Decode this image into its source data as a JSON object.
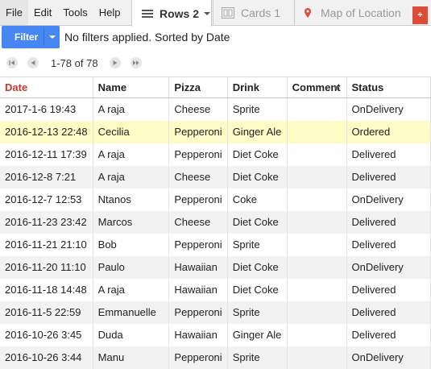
{
  "menu": {
    "file": "File",
    "edit": "Edit",
    "tools": "Tools",
    "help": "Help"
  },
  "tabs": [
    {
      "label": "Rows 2",
      "icon": "rows-icon",
      "active": true
    },
    {
      "label": "Cards 1",
      "icon": "cards-icon",
      "active": false
    },
    {
      "label": "Map of Location",
      "icon": "map-pin-icon",
      "active": false
    }
  ],
  "add_tab_label": "+",
  "filter": {
    "button_label": "Filter",
    "status_text": "No filters applied. Sorted by Date"
  },
  "pager": {
    "range_text": "1-78 of 78"
  },
  "table": {
    "columns": [
      "Date",
      "Name",
      "Pizza",
      "Drink",
      "Comment",
      "Status"
    ],
    "sorted_column": "Date",
    "rows": [
      [
        "2017-1-6 19:43",
        "A raja",
        "Cheese",
        "Sprite",
        "",
        "OnDelivery"
      ],
      [
        "2016-12-13 22:48",
        "Cecilia",
        "Pepperoni",
        "Ginger Ale",
        "",
        "Ordered"
      ],
      [
        "2016-12-11 17:39",
        "A raja",
        "Pepperoni",
        "Diet Coke",
        "",
        "Delivered"
      ],
      [
        "2016-12-8 7:21",
        "A raja",
        "Cheese",
        "Diet Coke",
        "",
        "Delivered"
      ],
      [
        "2016-12-7 12:53",
        "Ntanos",
        "Pepperoni",
        "Coke",
        "",
        "OnDelivery"
      ],
      [
        "2016-11-23 23:42",
        "Marcos",
        "Cheese",
        "Diet Coke",
        "",
        "Delivered"
      ],
      [
        "2016-11-21 21:10",
        "Bob",
        "Pepperoni",
        "Sprite",
        "",
        "Delivered"
      ],
      [
        "2016-11-20 11:10",
        "Paulo",
        "Hawaiian",
        "Diet Coke",
        "",
        "OnDelivery"
      ],
      [
        "2016-11-18 14:48",
        "A raja",
        "Hawaiian",
        "Diet Coke",
        "",
        "Delivered"
      ],
      [
        "2016-11-5 22:59",
        "Emmanuelle",
        "Pepperoni",
        "Sprite",
        "",
        "Delivered"
      ],
      [
        "2016-10-26 3:45",
        "Duda",
        "Hawaiian",
        "Ginger Ale",
        "",
        "Delivered"
      ],
      [
        "2016-10-26 3:44",
        "Manu",
        "Pepperoni",
        "Sprite",
        "",
        "OnDelivery"
      ]
    ],
    "highlighted_row": 1
  },
  "colors": {
    "accent": "#4687f4",
    "sorted_header": "#c0392b",
    "highlight": "#fffbc6",
    "add_button": "#dd4b39"
  }
}
